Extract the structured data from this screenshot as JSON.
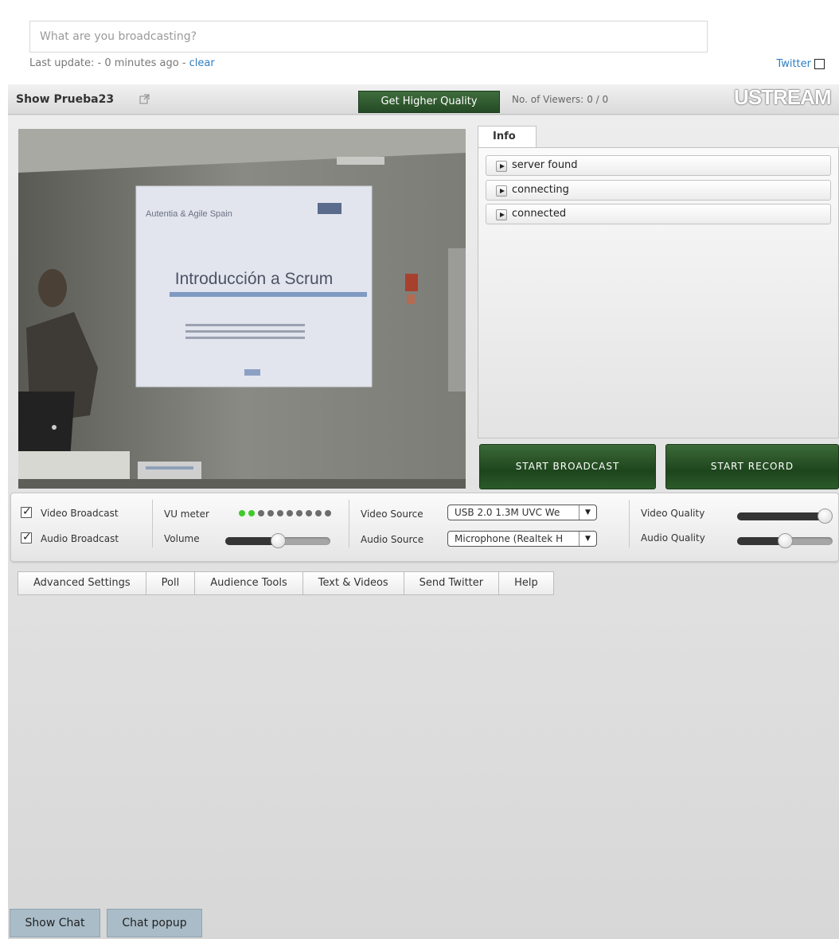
{
  "status": {
    "placeholder": "What are you broadcasting?",
    "last_update_prefix": "Last update: - 0 minutes ago - ",
    "clear_label": "clear",
    "twitter_label": "Twitter"
  },
  "header": {
    "show_title": "Show Prueba23",
    "quality_button": "Get Higher Quality",
    "viewers_label": "No. of Viewers:",
    "viewers_value": "0 / 0",
    "brand": "USTREAM"
  },
  "video": {
    "slide_brand": "Autentia & Agile Spain",
    "slide_title": "Introducción a Scrum"
  },
  "info": {
    "tab_label": "Info",
    "log": [
      "server found",
      "connecting",
      "connected"
    ]
  },
  "actions": {
    "start_broadcast": "START BROADCAST",
    "start_record": "START RECORD"
  },
  "controls": {
    "video_broadcast_label": "Video Broadcast",
    "audio_broadcast_label": "Audio Broadcast",
    "video_broadcast_checked": true,
    "audio_broadcast_checked": true,
    "vu_meter_label": "VU meter",
    "vu_meter_active": 2,
    "vu_meter_total": 10,
    "volume_label": "Volume",
    "volume_level": 0.5,
    "video_source_label": "Video Source",
    "video_source_value": "USB 2.0 1.3M UVC We",
    "audio_source_label": "Audio Source",
    "audio_source_value": "Microphone (Realtek H",
    "video_quality_label": "Video Quality",
    "video_quality_level": 0.95,
    "audio_quality_label": "Audio Quality",
    "audio_quality_level": 0.5
  },
  "tabs": [
    "Advanced Settings",
    "Poll",
    "Audience Tools",
    "Text & Videos",
    "Send Twitter",
    "Help"
  ],
  "chat": {
    "show_chat": "Show Chat",
    "chat_popup": "Chat popup"
  },
  "colors": {
    "accent_green": "#2a5228",
    "link_blue": "#2e7fc4",
    "vu_on": "#3ecb2a",
    "chat_button": "#a9bcc8"
  }
}
